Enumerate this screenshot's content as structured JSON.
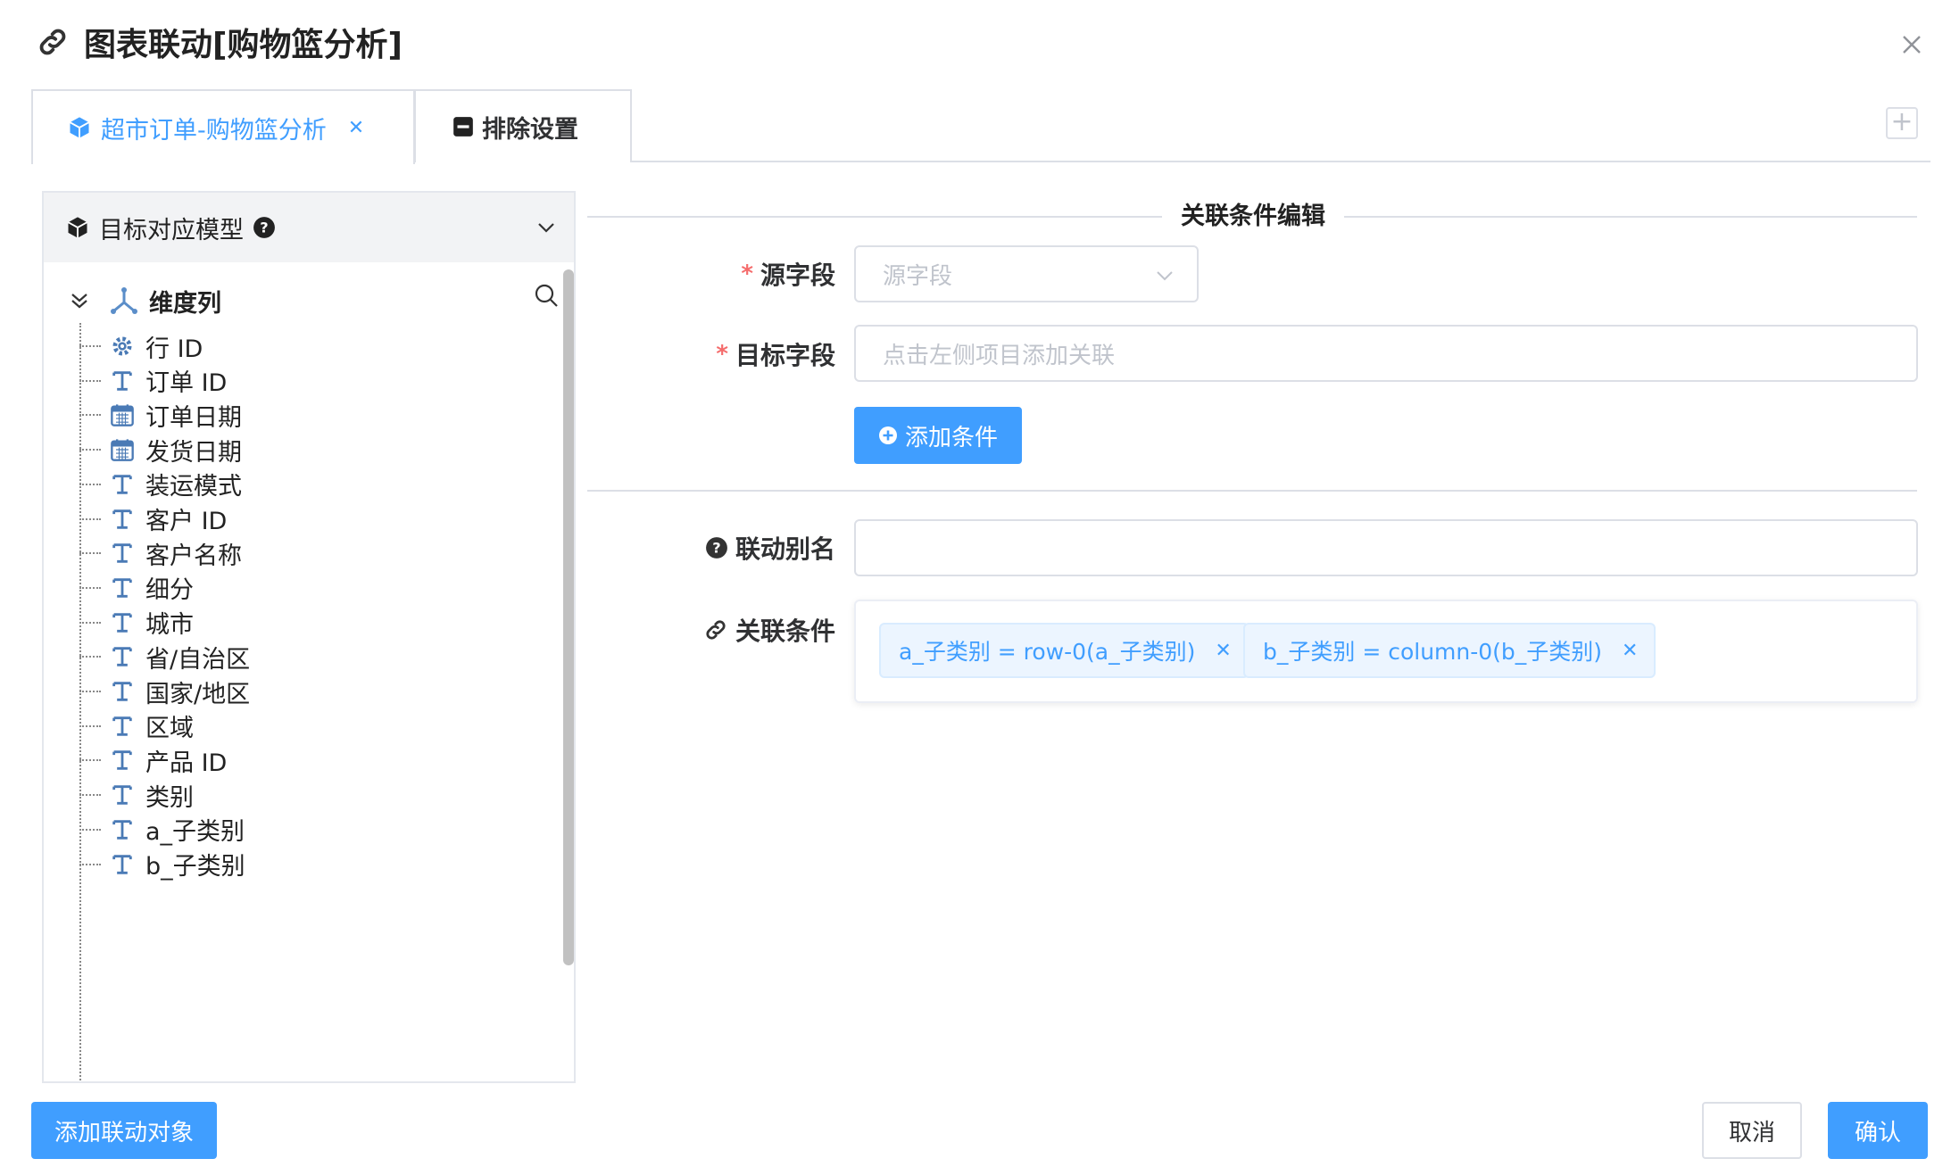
{
  "dialog": {
    "title": "图表联动[购物篮分析]"
  },
  "tabs": [
    {
      "label": "超市订单-购物篮分析",
      "closable": true,
      "active": true
    },
    {
      "label": "排除设置",
      "closable": false,
      "active": false
    }
  ],
  "left_panel": {
    "header": "目标对应模型",
    "root": "维度列",
    "fields": [
      {
        "label": "行 ID",
        "icon": "gear-icon"
      },
      {
        "label": "订单 ID",
        "icon": "text-icon"
      },
      {
        "label": "订单日期",
        "icon": "calendar-icon"
      },
      {
        "label": "发货日期",
        "icon": "calendar-icon"
      },
      {
        "label": "装运模式",
        "icon": "text-icon"
      },
      {
        "label": "客户 ID",
        "icon": "text-icon"
      },
      {
        "label": "客户名称",
        "icon": "text-icon"
      },
      {
        "label": "细分",
        "icon": "text-icon"
      },
      {
        "label": "城市",
        "icon": "text-icon"
      },
      {
        "label": "省/自治区",
        "icon": "text-icon"
      },
      {
        "label": "国家/地区",
        "icon": "text-icon"
      },
      {
        "label": "区域",
        "icon": "text-icon"
      },
      {
        "label": "产品 ID",
        "icon": "text-icon"
      },
      {
        "label": "类别",
        "icon": "text-icon"
      },
      {
        "label": "a_子类别",
        "icon": "text-icon"
      },
      {
        "label": "b_子类别",
        "icon": "text-icon"
      }
    ]
  },
  "form": {
    "section_title": "关联条件编辑",
    "source_label": "源字段",
    "source_placeholder": "源字段",
    "target_label": "目标字段",
    "target_placeholder": "点击左侧项目添加关联",
    "add_condition": "添加条件",
    "alias_label": "联动别名",
    "alias_value": "",
    "conditions_label": "关联条件",
    "conditions": [
      "a_子类别 = row-0(a_子类别)",
      "b_子类别 = column-0(b_子类别)"
    ]
  },
  "footer": {
    "add_target": "添加联动对象",
    "cancel": "取消",
    "confirm": "确认"
  },
  "colors": {
    "primary": "#409eff",
    "required": "#f56c6c",
    "border": "#dcdfe6"
  }
}
